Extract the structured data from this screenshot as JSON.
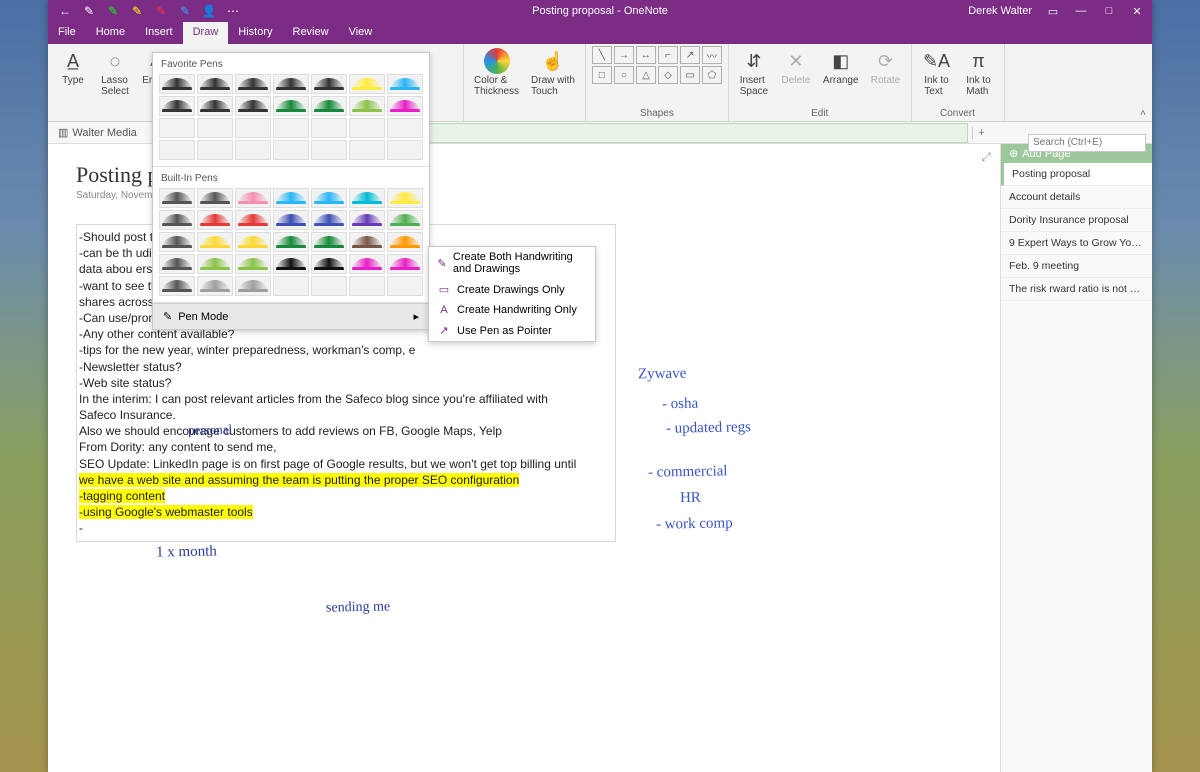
{
  "app": {
    "title": "Posting proposal  -  OneNote",
    "user": "Derek Walter"
  },
  "qat": {
    "back": "←",
    "p1": "✎",
    "p2": "✎",
    "p3": "✎",
    "p4": "✎",
    "p5": "✎",
    "user": "👤",
    "more": "⋯"
  },
  "qat_colors": [
    "#fff",
    "#0f0",
    "#ff0",
    "#f33",
    "#3af"
  ],
  "menu": {
    "items": [
      "File",
      "Home",
      "Insert",
      "Draw",
      "History",
      "Review",
      "View"
    ],
    "active": 3
  },
  "ribbon": {
    "type": "Type",
    "lasso": "Lasso\nSelect",
    "eraser": "Eraser",
    "color": "Color &\nThickness",
    "touch": "Draw with\nTouch",
    "insertspace": "Insert\nSpace",
    "delete": "Delete",
    "arrange": "Arrange",
    "rotate": "Rotate",
    "inktext": "Ink to\nText",
    "inkmath": "Ink to\nMath",
    "grp_shapes": "Shapes",
    "grp_edit": "Edit",
    "grp_convert": "Convert"
  },
  "favorite_label": "Favorite Pens",
  "builtin_label": "Built-In Pens",
  "favorite_colors": [
    [
      "#333",
      "#333",
      "#333",
      "#333",
      "#333",
      "#ffeb3b",
      "#29b6f6"
    ],
    [
      "#333",
      "#333",
      "#333",
      "#168a3a",
      "#168a3a",
      "#8bc34a",
      "#e91ec6"
    ],
    [
      "",
      "",
      "",
      "",
      "",
      "",
      ""
    ],
    [
      "",
      "",
      "",
      "",
      "",
      "",
      ""
    ]
  ],
  "builtin_colors": [
    [
      "#555",
      "#555",
      "#f48fb1",
      "#29b6f6",
      "#29b6f6",
      "#00bcd4",
      "#ffeb3b"
    ],
    [
      "#555",
      "#e53935",
      "#e53935",
      "#3f51b5",
      "#3f51b5",
      "#673ab7",
      "#4caf50"
    ],
    [
      "#555",
      "#fdd835",
      "#fdd835",
      "#168a3a",
      "#168a3a",
      "#795548",
      "#ff9800"
    ],
    [
      "#555",
      "#8bc34a",
      "#8bc34a",
      "#111",
      "#111",
      "#e91ec6",
      "#e91ec6"
    ],
    [
      "#555",
      "#9e9e9e",
      "#9e9e9e",
      "",
      "",
      "",
      ""
    ]
  ],
  "penmode_label": "Pen Mode",
  "penmode_items": [
    "Create Both Handwriting and Drawings",
    "Create Drawings Only",
    "Create Handwriting Only",
    "Use Pen as Pointer"
  ],
  "notebook": "Walter Media",
  "section_add": "+",
  "search_ph": "Search (Ctrl+E)",
  "addpage": "Add Page",
  "pages": [
    "Posting proposal",
    "Account details",
    "Dority Insurance proposal",
    "9 Expert Ways to Grow Your Email List",
    "Feb. 9 meeting",
    "The risk rward ratio is not great. All the"
  ],
  "page": {
    "title": "Posting pr",
    "date": "Saturday, November",
    "lines": [
      "-Should post to",
      "    -can be th                                                                 udience, once we get more",
      "     data abou                                                                 ersify",
      "-want to see th                                                               omething that will drive",
      "shares across F",
      "-Can use/prom",
      "-Any other content available?",
      "    -tips for the new year, winter preparedness, workman's comp, e",
      "-Newsletter status?",
      "-Web site status?",
      "",
      "In the interim: I can post relevant articles from the Safeco blog since you're affiliated with",
      "Safeco Insurance.",
      "Also we should encourage customers to add reviews on FB, Google Maps, Yelp",
      "From Dority: any content to send me,",
      "SEO Update: LinkedIn page is on first page of Google results, but we won't get top billing until"
    ],
    "hl1": "we have a web site and assuming the team is putting the proper SEO configuration",
    "hl2": "-tagging content",
    "hl3": "-using Google's webmaster tools",
    "dash": "-"
  },
  "ink": {
    "a": "personal",
    "b": "1 x month",
    "c": "sending   me",
    "d": "Zywave",
    "e": "- osha",
    "f": "- updated regs",
    "g": "- commercial",
    "h": "HR",
    "i": "- work comp"
  },
  "win": {
    "min": "—",
    "max": "□",
    "close": "✕",
    "rest": "▭"
  }
}
